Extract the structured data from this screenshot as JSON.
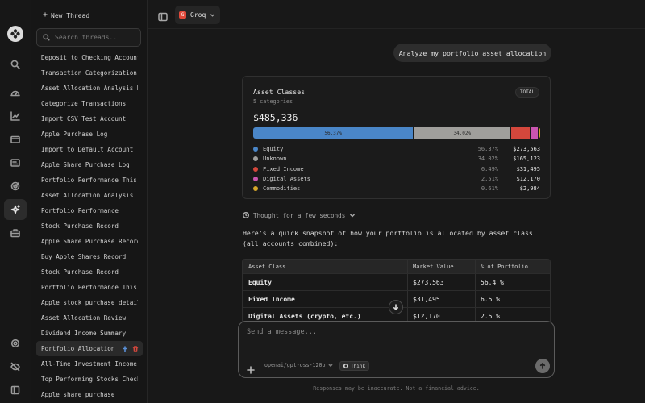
{
  "sidebar": {
    "new_thread_label": "New Thread",
    "search_placeholder": "Search threads...",
    "threads": [
      "Deposit to Checking Account",
      "Transaction Categorization ...",
      "Asset Allocation Analysis R...",
      "Categorize Transactions",
      "Import CSV Test Account",
      "Apple Purchase Log",
      "Import to Default Account",
      "Apple Share Purchase Log",
      "Portfolio Performance This ...",
      "Asset Allocation Analysis",
      "Portfolio Performance",
      "Stock Purchase Record",
      "Apple Share Purchase Record",
      "Buy Apple Shares Record",
      "Stock Purchase Record",
      "Portfolio Performance This ...",
      "Apple stock purchase details",
      "Asset Allocation Review",
      "Dividend Income Summary",
      "Portfolio Allocation ...",
      "All-Time Investment Income",
      "Top Performing Stocks Check",
      "Apple share purchase"
    ],
    "active_index": 19
  },
  "header": {
    "model_provider": "Groq",
    "provider_badge": "G"
  },
  "chat": {
    "user_message": "Analyze my portfolio asset allocation",
    "card": {
      "title": "Asset Classes",
      "subtitle": "5 categories",
      "badge": "TOTAL",
      "total": "$485,336",
      "classes": [
        {
          "name": "Equity",
          "pct": 56.37,
          "pct_label": "56.37%",
          "value": "$273,563",
          "color": "#4a86c8"
        },
        {
          "name": "Unknown",
          "pct": 34.02,
          "pct_label": "34.02%",
          "value": "$165,123",
          "color": "#a09f9c"
        },
        {
          "name": "Fixed Income",
          "pct": 6.49,
          "pct_label": "6.49%",
          "value": "$31,495",
          "color": "#d4473c"
        },
        {
          "name": "Digital Assets",
          "pct": 2.51,
          "pct_label": "2.51%",
          "value": "$12,170",
          "color": "#c955b0"
        },
        {
          "name": "Commodities",
          "pct": 0.61,
          "pct_label": "0.61%",
          "value": "$2,984",
          "color": "#d4a62a"
        }
      ]
    },
    "thought_label": "Thought for a few seconds",
    "answer_text": "Here’s a quick snapshot of how your portfolio is allocated by asset class (all accounts combined):",
    "table": {
      "headers": [
        "Asset Class",
        "Market Value",
        "% of Portfolio"
      ],
      "rows": [
        [
          "Equity",
          "$273,563",
          "56.4 %"
        ],
        [
          "Fixed Income",
          "$31,495",
          "6.5 %"
        ],
        [
          "Digital Assets (crypto, etc.)",
          "$12,170",
          "2.5 %"
        ]
      ]
    }
  },
  "composer": {
    "placeholder": "Send a message...",
    "model": "openai/gpt-oss-120b",
    "think_label": "Think"
  },
  "disclaimer": "Responses may be inaccurate. Not a financial advice."
}
